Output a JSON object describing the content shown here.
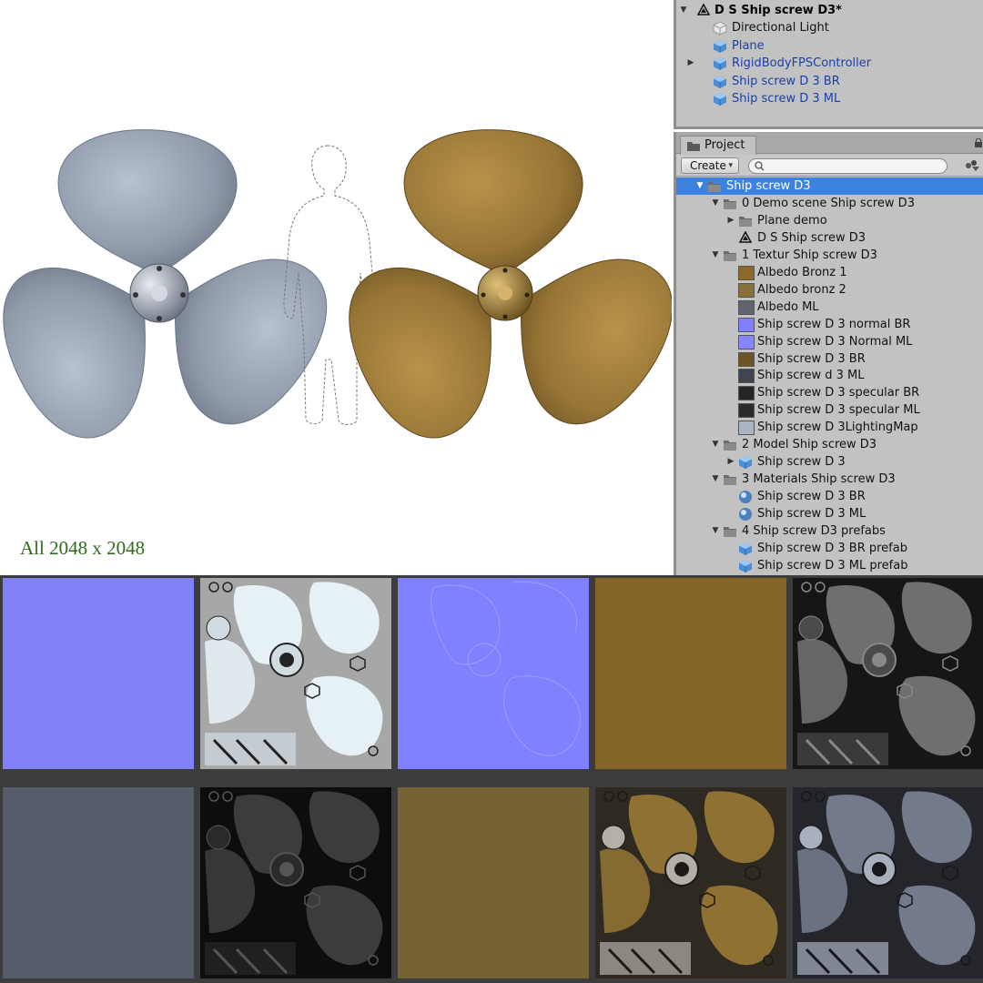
{
  "caption": "All 2048 x 2048",
  "hierarchy": {
    "items": [
      {
        "label": "D S Ship screw D3*",
        "kind": "scene",
        "arrow": "▼",
        "icon": "unity-scene-icon"
      },
      {
        "label": "Directional Light",
        "kind": "plain",
        "icon": "light-cube-icon"
      },
      {
        "label": "Plane",
        "kind": "prefab",
        "icon": "prefab-cube-icon"
      },
      {
        "label": "RigidBodyFPSController",
        "kind": "prefab",
        "arrow": "▶",
        "icon": "prefab-cube-icon"
      },
      {
        "label": "Ship screw D 3 BR",
        "kind": "prefab",
        "icon": "model-prefab-icon"
      },
      {
        "label": "Ship screw D 3 ML",
        "kind": "prefab",
        "icon": "model-prefab-icon"
      }
    ]
  },
  "project": {
    "tab_label": "Project",
    "create_label": "Create",
    "search_value": "",
    "tree": [
      {
        "label": "Ship screw D3",
        "depth": 0,
        "arrow": "▼",
        "icon": "folder",
        "selected": true
      },
      {
        "label": "0 Demo scene Ship screw D3",
        "depth": 1,
        "arrow": "▼",
        "icon": "folder"
      },
      {
        "label": "Plane demo",
        "depth": 2,
        "arrow": "▶",
        "icon": "folder"
      },
      {
        "label": "D S Ship screw D3",
        "depth": 2,
        "icon": "scene"
      },
      {
        "label": "1 Textur Ship screw D3",
        "depth": 1,
        "arrow": "▼",
        "icon": "folder"
      },
      {
        "label": "Albedo Bronz 1",
        "depth": 2,
        "icon": "swatch",
        "color": "#8a6a2c"
      },
      {
        "label": "Albedo bronz 2",
        "depth": 2,
        "icon": "swatch",
        "color": "#86703c"
      },
      {
        "label": "Albedo ML",
        "depth": 2,
        "icon": "swatch",
        "color": "#60646f"
      },
      {
        "label": "Ship screw D 3  normal BR",
        "depth": 2,
        "icon": "swatch",
        "color": "#8080ff"
      },
      {
        "label": "Ship screw D 3  Normal ML",
        "depth": 2,
        "icon": "swatch",
        "color": "#8585ff"
      },
      {
        "label": "Ship screw D 3 BR",
        "depth": 2,
        "icon": "swatch",
        "color": "#6a5428"
      },
      {
        "label": "Ship screw d 3 ML",
        "depth": 2,
        "icon": "swatch",
        "color": "#3f4450"
      },
      {
        "label": "Ship screw D 3 specular BR",
        "depth": 2,
        "icon": "swatch",
        "color": "#262626"
      },
      {
        "label": "Ship screw D 3 specular ML",
        "depth": 2,
        "icon": "swatch",
        "color": "#2c2c2c"
      },
      {
        "label": "Ship screw D 3LightingMap",
        "depth": 2,
        "icon": "swatch",
        "color": "#a8b4c0"
      },
      {
        "label": "2 Model Ship screw D3",
        "depth": 1,
        "arrow": "▼",
        "icon": "folder"
      },
      {
        "label": "Ship screw D 3",
        "depth": 2,
        "arrow": "▶",
        "icon": "model"
      },
      {
        "label": "3 Materials  Ship screw D3",
        "depth": 1,
        "arrow": "▼",
        "icon": "folder"
      },
      {
        "label": "Ship screw D 3 BR",
        "depth": 2,
        "icon": "material"
      },
      {
        "label": "Ship screw D 3 ML",
        "depth": 2,
        "icon": "material"
      },
      {
        "label": "4 Ship screw D3 prefabs",
        "depth": 1,
        "arrow": "▼",
        "icon": "folder"
      },
      {
        "label": "Ship screw D 3 BR prefab",
        "depth": 2,
        "icon": "prefab"
      },
      {
        "label": "Ship screw D 3 ML prefab",
        "depth": 2,
        "icon": "prefab"
      }
    ]
  },
  "colors": {
    "selection": "#3d82e0",
    "hierarchy_link": "#1a3fa8",
    "caption_green": "#2e6b1f",
    "propeller_steel": "#8e9aab",
    "propeller_bronze": "#9a7a36",
    "normal_map": "#7f7ff5"
  },
  "texture_swatches": [
    {
      "name": "normal-map-plain",
      "style": "normal"
    },
    {
      "name": "lighting-map-uv",
      "style": "uv-light"
    },
    {
      "name": "normal-map-detail",
      "style": "normal-detail"
    },
    {
      "name": "albedo-bronze",
      "style": "flat",
      "color": "#8d6c2a"
    },
    {
      "name": "specular-uv-dark",
      "style": "uv-dark"
    },
    {
      "name": "albedo-metal",
      "style": "flat",
      "color": "#5d6272"
    },
    {
      "name": "specular-uv-black",
      "style": "uv-black"
    },
    {
      "name": "albedo-bronze-2",
      "style": "flat",
      "color": "#7d6a3a"
    },
    {
      "name": "diffuse-uv-bronze",
      "style": "uv-bronze"
    },
    {
      "name": "diffuse-uv-metal",
      "style": "uv-metal"
    }
  ]
}
